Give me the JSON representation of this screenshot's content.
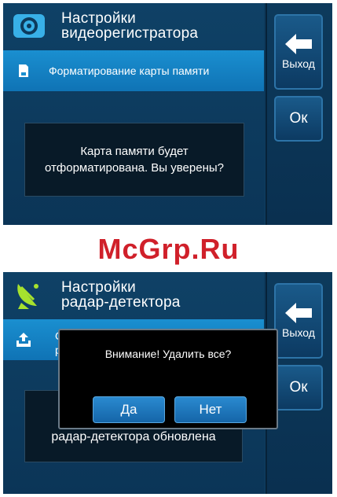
{
  "top_screen": {
    "title_line1": "Настройки",
    "title_line2": "видеорегистратора",
    "header_icon": "camera-icon",
    "subbar_icon": "sd-card-icon",
    "subbar_label": "Форматирование карты памяти",
    "message_line1": "Карта памяти будет",
    "message_line2": "отформатирована. Вы уверены?",
    "exit_label": "Выход",
    "ok_label": "Ок"
  },
  "watermark": "McGrp.Ru",
  "bottom_screen": {
    "title_line1": "Настройки",
    "title_line2": "радар-детектора",
    "header_icon": "radar-dish-icon",
    "subbar_icon": "upload-tray-icon",
    "subbar_partial_line1": "О",
    "subbar_partial_line2": "р",
    "background_message": "радар-детектора обновлена",
    "exit_label": "Выход",
    "ok_label": "Ок",
    "dialog": {
      "text": "Внимание! Удалить все?",
      "yes_label": "Да",
      "no_label": "Нет"
    }
  },
  "colors": {
    "screen_bg": "#0d3a5c",
    "subbar_blue": "#1a8fd0",
    "watermark_red": "#d0202a",
    "dialog_bg": "#000000",
    "accent_green": "#a6e22e"
  }
}
